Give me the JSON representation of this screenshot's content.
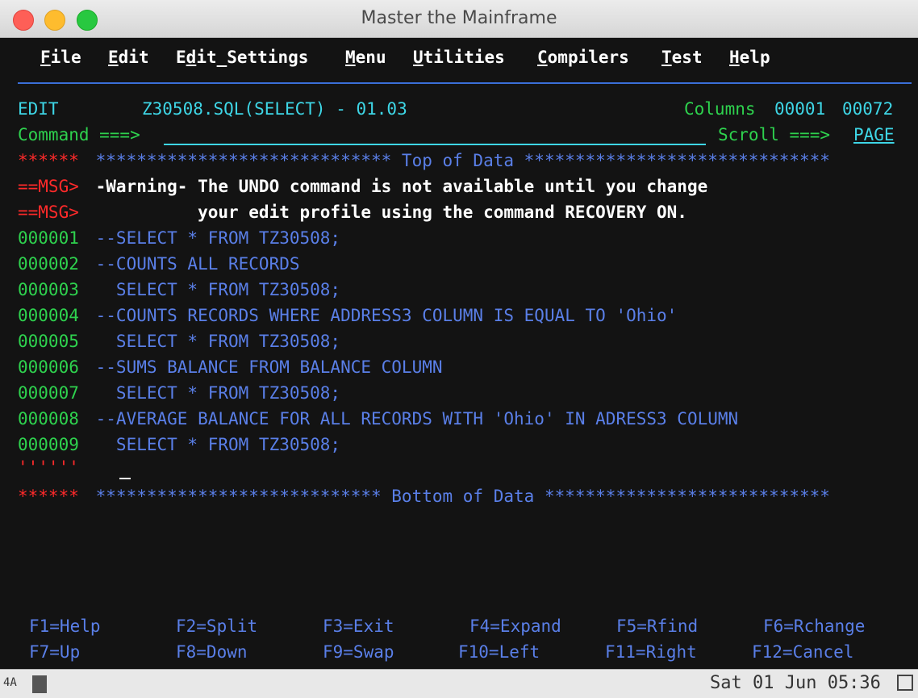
{
  "window": {
    "title": "Master the Mainframe"
  },
  "menu": {
    "items": [
      {
        "first": "F",
        "rest": "ile"
      },
      {
        "first": "E",
        "rest": "dit"
      },
      {
        "first": "",
        "mid1": "E",
        "mid2": "d",
        "mid3": "it_Settings"
      },
      {
        "first": "M",
        "rest": "enu"
      },
      {
        "first": "U",
        "rest": "tilities"
      },
      {
        "first": "C",
        "rest": "ompilers"
      },
      {
        "first": "T",
        "rest": "est"
      },
      {
        "first": "H",
        "rest": "elp"
      }
    ]
  },
  "header": {
    "mode": "EDIT",
    "dataset": "Z30508.SQL(SELECT) - 01.03",
    "columns_label": "Columns",
    "col_start": "00001",
    "col_end": "00072",
    "command_label": "Command ===>",
    "command_value": "",
    "scroll_label": "Scroll ===>",
    "scroll_value": "PAGE"
  },
  "top_marker": {
    "prefix": "******",
    "text": " ***************************** Top of Data ******************************"
  },
  "messages": [
    {
      "prefix": "==MSG>",
      "text": " -Warning- The UNDO command is not available until you change"
    },
    {
      "prefix": "==MSG>",
      "text": "           your edit profile using the command RECOVERY ON."
    }
  ],
  "lines": [
    {
      "num": "000001",
      "text": " --SELECT * FROM TZ30508;"
    },
    {
      "num": "000002",
      "text": " --COUNTS ALL RECORDS"
    },
    {
      "num": "000003",
      "text": "   SELECT * FROM TZ30508;"
    },
    {
      "num": "000004",
      "text": " --COUNTS RECORDS WHERE ADDRESS3 COLUMN IS EQUAL TO 'Ohio'"
    },
    {
      "num": "000005",
      "text": "   SELECT * FROM TZ30508;"
    },
    {
      "num": "000006",
      "text": " --SUMS BALANCE FROM BALANCE COLUMN"
    },
    {
      "num": "000007",
      "text": "   SELECT * FROM TZ30508;"
    },
    {
      "num": "000008",
      "text": " --AVERAGE BALANCE FOR ALL RECORDS WITH 'Ohio' IN ADRESS3 COLUMN"
    },
    {
      "num": "000009",
      "text": "   SELECT * FROM TZ30508;"
    }
  ],
  "insert_line": {
    "prefix": "''''''"
  },
  "bottom_marker": {
    "prefix": "******",
    "text": " **************************** Bottom of Data ****************************"
  },
  "pfkeys": {
    "row1": [
      "F1=Help",
      "F2=Split",
      "F3=Exit",
      "F4=Expand",
      "F5=Rfind",
      "F6=Rchange"
    ],
    "row2": [
      "F7=Up",
      "F8=Down",
      "F9=Swap",
      "F10=Left",
      "F11=Right",
      "F12=Cancel"
    ]
  },
  "statusbar": {
    "left_indicator": "4A",
    "datetime": "Sat 01 Jun 05:36"
  }
}
